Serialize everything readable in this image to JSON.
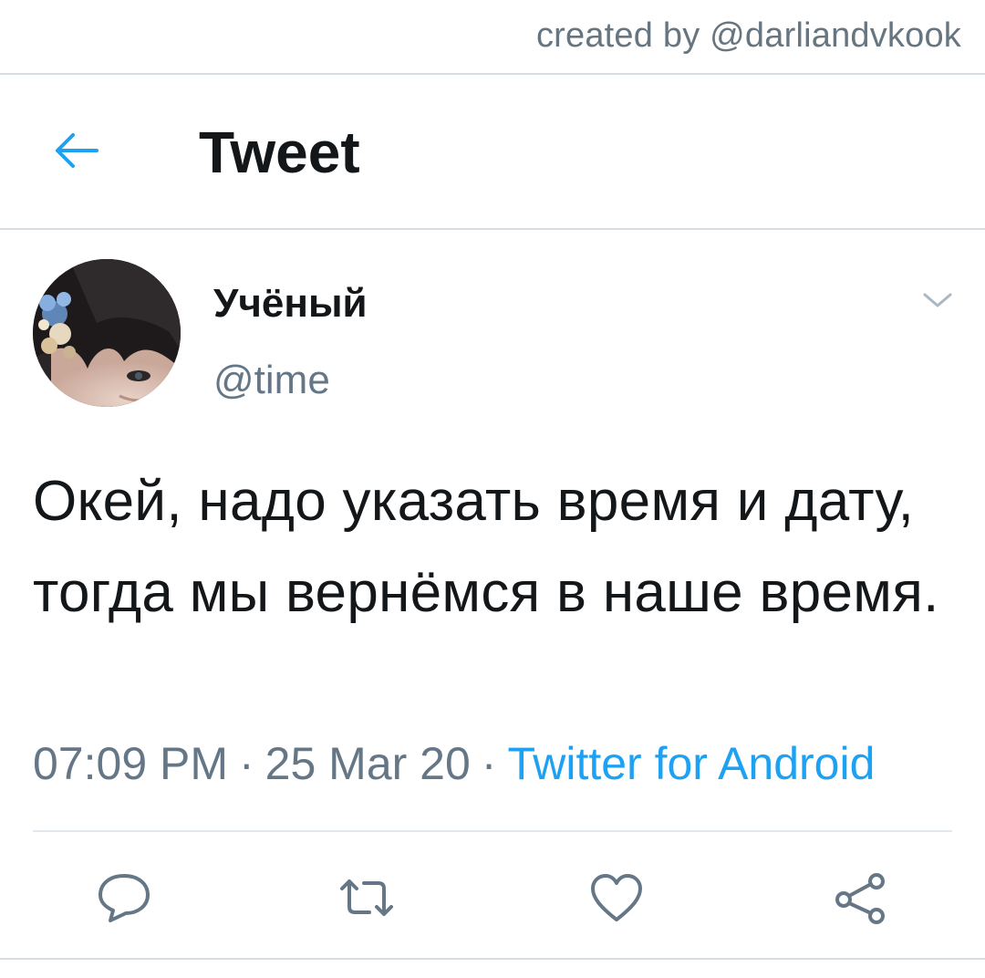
{
  "credit": "created by @darliandvkook",
  "header": {
    "back_icon": "arrow-left-icon",
    "title": "Tweet",
    "accent": "#1da1f2"
  },
  "tweet": {
    "author_name": "Учёный",
    "author_handle": "@time",
    "text": "Окей, надо указать время и дату, тогда мы вернёмся в наше время.",
    "time": "07:09 PM",
    "date": "25 Mar 20",
    "source": "Twitter for Android",
    "separator": "·"
  },
  "actions": [
    {
      "name": "reply",
      "icon": "speech-bubble-icon"
    },
    {
      "name": "retweet",
      "icon": "retweet-icon"
    },
    {
      "name": "like",
      "icon": "heart-icon"
    },
    {
      "name": "share",
      "icon": "share-icon"
    }
  ],
  "colors": {
    "text": "#14171a",
    "muted": "#657786",
    "link": "#1da1f2",
    "divider": "#e1e8ed"
  }
}
